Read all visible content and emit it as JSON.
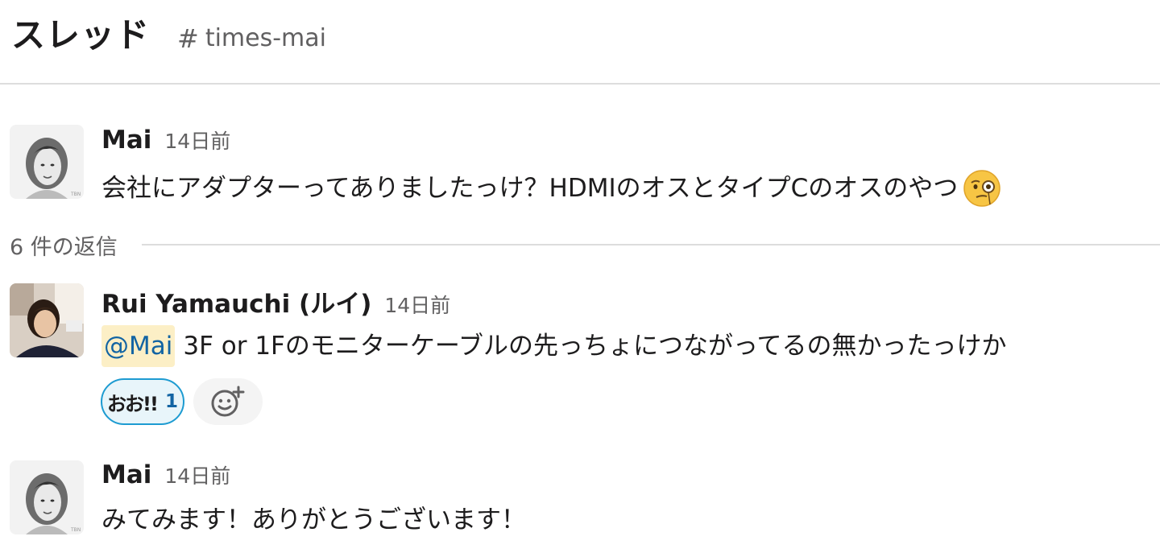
{
  "header": {
    "title": "スレッド",
    "channel_icon": "#",
    "channel": "times-mai"
  },
  "messages": [
    {
      "author": "Mai",
      "time": "14日前",
      "text": "会社にアダプターってありましたっけ？HDMIのオスとタイプCのオスのやつ",
      "emoji": "face-with-monocle-icon",
      "avatar": "mai-avatar"
    },
    {
      "author": "Rui Yamauchi (ルイ)",
      "time": "14日前",
      "mention": "@Mai",
      "text": "3F or 1Fのモニターケーブルの先っちょにつながってるの無かったっけか",
      "avatar": "rui-avatar"
    },
    {
      "author": "Mai",
      "time": "14日前",
      "text": "みてみます！ありがとうございます！",
      "avatar": "mai-avatar"
    }
  ],
  "replies": {
    "label": "6 件の返信"
  },
  "reaction": {
    "emoji": "おお!!",
    "count": "1"
  },
  "colors": {
    "mention_bg": "#fcefc6",
    "mention_text": "#1264a3",
    "reaction_border": "#1d9bd1"
  }
}
